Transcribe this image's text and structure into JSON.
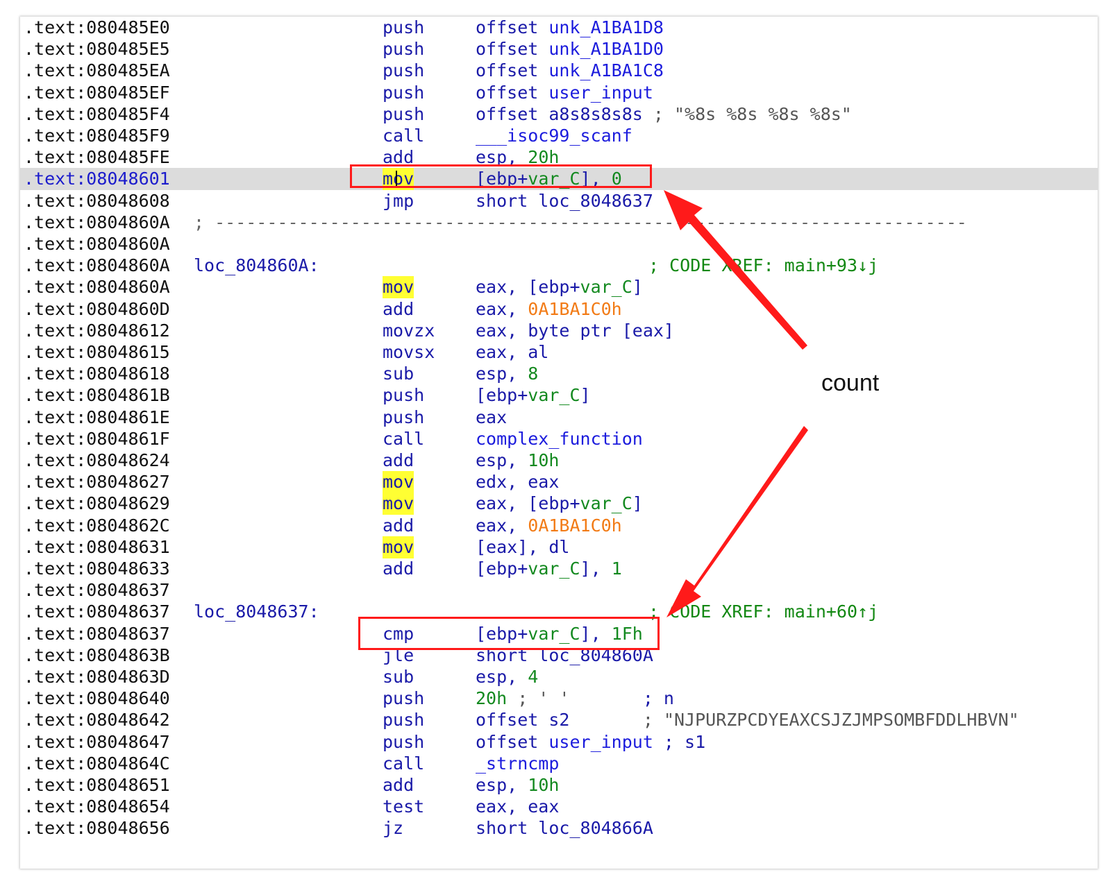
{
  "listing": {
    "lines": [
      {
        "addr": ".text:080485E0",
        "mnem": "push",
        "ops": [
          {
            "t": "offset ",
            "c": "reg"
          },
          {
            "t": "unk_A1BA1D8",
            "c": "sym"
          }
        ]
      },
      {
        "addr": ".text:080485E5",
        "mnem": "push",
        "ops": [
          {
            "t": "offset ",
            "c": "reg"
          },
          {
            "t": "unk_A1BA1D0",
            "c": "sym"
          }
        ]
      },
      {
        "addr": ".text:080485EA",
        "mnem": "push",
        "ops": [
          {
            "t": "offset ",
            "c": "reg"
          },
          {
            "t": "unk_A1BA1C8",
            "c": "sym"
          }
        ]
      },
      {
        "addr": ".text:080485EF",
        "mnem": "push",
        "ops": [
          {
            "t": "offset ",
            "c": "reg"
          },
          {
            "t": "user_input",
            "c": "sym"
          }
        ]
      },
      {
        "addr": ".text:080485F4",
        "mnem": "push",
        "ops": [
          {
            "t": "offset ",
            "c": "reg"
          },
          {
            "t": "a8s8s8s8s",
            "c": "reg"
          },
          {
            "t": " ; ",
            "c": "str"
          },
          {
            "t": "\"%8s %8s %8s %8s\"",
            "c": "str"
          }
        ]
      },
      {
        "addr": ".text:080485F9",
        "mnem": "call",
        "ops": [
          {
            "t": "___isoc99_scanf",
            "c": "sym"
          }
        ]
      },
      {
        "addr": ".text:080485FE",
        "mnem": "add",
        "ops": [
          {
            "t": "esp, ",
            "c": "reg"
          },
          {
            "t": "20h",
            "c": "num"
          }
        ]
      },
      {
        "addr": ".text:08048601",
        "mnem": "mov",
        "mnem_hl": true,
        "current": true,
        "ops": [
          {
            "t": "[ebp+",
            "c": "reg"
          },
          {
            "t": "var_C",
            "c": "num"
          },
          {
            "t": "], ",
            "c": "reg"
          },
          {
            "t": "0",
            "c": "num"
          }
        ]
      },
      {
        "addr": ".text:08048608",
        "mnem": "jmp",
        "ops": [
          {
            "t": "short loc_8048637",
            "c": "reg"
          }
        ]
      },
      {
        "addr": ".text:0804860A",
        "sep": "; ------------------------------------------------------------------------"
      },
      {
        "addr": ".text:0804860A"
      },
      {
        "addr": ".text:0804860A",
        "label": "loc_804860A:",
        "xref": "; CODE XREF: main+93↓j"
      },
      {
        "addr": ".text:0804860A",
        "mnem": "mov",
        "mnem_hl": true,
        "ops": [
          {
            "t": "eax, [ebp+",
            "c": "reg"
          },
          {
            "t": "var_C",
            "c": "num"
          },
          {
            "t": "]",
            "c": "reg"
          }
        ]
      },
      {
        "addr": ".text:0804860D",
        "mnem": "add",
        "ops": [
          {
            "t": "eax, ",
            "c": "reg"
          },
          {
            "t": "0A1BA1C0h",
            "c": "hex"
          }
        ]
      },
      {
        "addr": ".text:08048612",
        "mnem": "movzx",
        "ops": [
          {
            "t": "eax, byte ptr [eax]",
            "c": "reg"
          }
        ]
      },
      {
        "addr": ".text:08048615",
        "mnem": "movsx",
        "ops": [
          {
            "t": "eax, al",
            "c": "reg"
          }
        ]
      },
      {
        "addr": ".text:08048618",
        "mnem": "sub",
        "ops": [
          {
            "t": "esp, ",
            "c": "reg"
          },
          {
            "t": "8",
            "c": "num"
          }
        ]
      },
      {
        "addr": ".text:0804861B",
        "mnem": "push",
        "ops": [
          {
            "t": "[ebp+",
            "c": "reg"
          },
          {
            "t": "var_C",
            "c": "num"
          },
          {
            "t": "]",
            "c": "reg"
          }
        ]
      },
      {
        "addr": ".text:0804861E",
        "mnem": "push",
        "ops": [
          {
            "t": "eax",
            "c": "reg"
          }
        ]
      },
      {
        "addr": ".text:0804861F",
        "mnem": "call",
        "ops": [
          {
            "t": "complex_function",
            "c": "sym"
          }
        ]
      },
      {
        "addr": ".text:08048624",
        "mnem": "add",
        "ops": [
          {
            "t": "esp, ",
            "c": "reg"
          },
          {
            "t": "10h",
            "c": "num"
          }
        ]
      },
      {
        "addr": ".text:08048627",
        "mnem": "mov",
        "mnem_hl": true,
        "ops": [
          {
            "t": "edx, eax",
            "c": "reg"
          }
        ]
      },
      {
        "addr": ".text:08048629",
        "mnem": "mov",
        "mnem_hl": true,
        "ops": [
          {
            "t": "eax, [ebp+",
            "c": "reg"
          },
          {
            "t": "var_C",
            "c": "num"
          },
          {
            "t": "]",
            "c": "reg"
          }
        ]
      },
      {
        "addr": ".text:0804862C",
        "mnem": "add",
        "ops": [
          {
            "t": "eax, ",
            "c": "reg"
          },
          {
            "t": "0A1BA1C0h",
            "c": "hex"
          }
        ]
      },
      {
        "addr": ".text:08048631",
        "mnem": "mov",
        "mnem_hl": true,
        "ops": [
          {
            "t": "[eax], dl",
            "c": "reg"
          }
        ]
      },
      {
        "addr": ".text:08048633",
        "mnem": "add",
        "ops": [
          {
            "t": "[ebp+",
            "c": "reg"
          },
          {
            "t": "var_C",
            "c": "num"
          },
          {
            "t": "], ",
            "c": "reg"
          },
          {
            "t": "1",
            "c": "num"
          }
        ]
      },
      {
        "addr": ".text:08048637"
      },
      {
        "addr": ".text:08048637",
        "label": "loc_8048637:",
        "xref": "; CODE XREF: main+60↑j"
      },
      {
        "addr": ".text:08048637",
        "mnem": "cmp",
        "ops": [
          {
            "t": "[ebp+",
            "c": "reg"
          },
          {
            "t": "var_C",
            "c": "num"
          },
          {
            "t": "], ",
            "c": "reg"
          },
          {
            "t": "1Fh",
            "c": "num"
          }
        ]
      },
      {
        "addr": ".text:0804863B",
        "mnem": "jle",
        "ops": [
          {
            "t": "short loc_804860A",
            "c": "reg"
          }
        ]
      },
      {
        "addr": ".text:0804863D",
        "mnem": "sub",
        "ops": [
          {
            "t": "esp, ",
            "c": "reg"
          },
          {
            "t": "4",
            "c": "num"
          }
        ]
      },
      {
        "addr": ".text:08048640",
        "mnem": "push",
        "ops": [
          {
            "t": "20h",
            "c": "num"
          },
          {
            "t": " ; ' '",
            "c": "str"
          },
          {
            "t": "       ; n",
            "c": "reg"
          }
        ]
      },
      {
        "addr": ".text:08048642",
        "mnem": "push",
        "ops": [
          {
            "t": "offset s2",
            "c": "reg"
          },
          {
            "t": "       ; ",
            "c": "str"
          },
          {
            "t": "\"NJPURZPCDYEAXCSJZJMPSOMBFDDLHBVN\"",
            "c": "str"
          }
        ]
      },
      {
        "addr": ".text:08048647",
        "mnem": "push",
        "ops": [
          {
            "t": "offset ",
            "c": "reg"
          },
          {
            "t": "user_input",
            "c": "sym"
          },
          {
            "t": " ; s1",
            "c": "reg"
          }
        ]
      },
      {
        "addr": ".text:0804864C",
        "mnem": "call",
        "ops": [
          {
            "t": "_strncmp",
            "c": "sym"
          }
        ]
      },
      {
        "addr": ".text:08048651",
        "mnem": "add",
        "ops": [
          {
            "t": "esp, ",
            "c": "reg"
          },
          {
            "t": "10h",
            "c": "num"
          }
        ]
      },
      {
        "addr": ".text:08048654",
        "mnem": "test",
        "ops": [
          {
            "t": "eax, eax",
            "c": "reg"
          }
        ]
      },
      {
        "addr": ".text:08048656",
        "mnem": "jz",
        "ops": [
          {
            "t": "short loc_804866A",
            "c": "reg"
          }
        ]
      }
    ]
  },
  "annotation": {
    "label": "count",
    "color": "#ff1a1a"
  },
  "colors": {
    "highlight": "#ffff33",
    "current_line": "#dcdcdc",
    "number": "#13891f",
    "hex_const": "#f27b16",
    "comment": "#138813"
  }
}
